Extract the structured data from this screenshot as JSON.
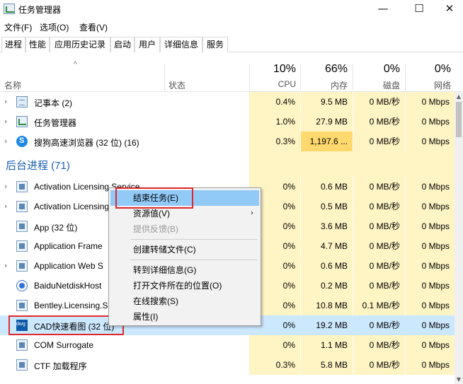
{
  "window": {
    "title": "任务管理器",
    "minimize_glyph": "—",
    "maximize_glyph": "☐",
    "close_glyph": "✕"
  },
  "menubar": {
    "items": [
      "文件(F)",
      "选项(O)",
      "查看(V)"
    ]
  },
  "tabs": {
    "items": [
      "进程",
      "性能",
      "应用历史记录",
      "启动",
      "用户",
      "详细信息",
      "服务"
    ],
    "active": "进程"
  },
  "columns": {
    "sort_indicator": "^",
    "name": "名称",
    "status": "状态",
    "cpu": {
      "percent": "10%",
      "label": "CPU"
    },
    "memory": {
      "percent": "66%",
      "label": "内存"
    },
    "disk": {
      "percent": "0%",
      "label": "磁盘"
    },
    "network": {
      "percent": "0%",
      "label": "网络"
    }
  },
  "apps": [
    {
      "name": "记事本 (2)",
      "icon": "notepad-icon",
      "expander": "›",
      "cpu": "0.4%",
      "memory": "9.5 MB",
      "disk": "0 MB/秒",
      "network": "0 Mbps"
    },
    {
      "name": "任务管理器",
      "icon": "task-manager-icon",
      "expander": "›",
      "cpu": "1.0%",
      "memory": "27.9 MB",
      "disk": "0 MB/秒",
      "network": "0 Mbps"
    },
    {
      "name": "搜狗高速浏览器 (32 位) (16)",
      "icon": "sogou-browser-icon",
      "expander": "›",
      "cpu": "0.3%",
      "memory": "1,197.6 ...",
      "disk": "0 MB/秒",
      "network": "0 Mbps"
    }
  ],
  "background_group": {
    "label": "后台进程 (71)"
  },
  "background": [
    {
      "name": "Activation Licensing Service",
      "icon": "service-icon",
      "expander": "›",
      "cpu": "0%",
      "memory": "0.6 MB",
      "disk": "0 MB/秒",
      "network": "0 Mbps"
    },
    {
      "name": "Activation Licensing",
      "icon": "service-icon",
      "expander": "›",
      "cpu": "0%",
      "memory": "0.5 MB",
      "disk": "0 MB/秒",
      "network": "0 Mbps"
    },
    {
      "name": "App (32 位)",
      "icon": "app-icon",
      "expander": "",
      "cpu": "0%",
      "memory": "3.6 MB",
      "disk": "0 MB/秒",
      "network": "0 Mbps"
    },
    {
      "name": "Application Frame",
      "icon": "app-icon",
      "expander": "",
      "cpu": "0%",
      "memory": "4.7 MB",
      "disk": "0 MB/秒",
      "network": "0 Mbps"
    },
    {
      "name": "Application Web S",
      "icon": "app-icon",
      "expander": "›",
      "cpu": "0%",
      "memory": "0.6 MB",
      "disk": "0 MB/秒",
      "network": "0 Mbps"
    },
    {
      "name": "BaiduNetdiskHost",
      "icon": "baidu-netdisk-icon",
      "expander": "",
      "cpu": "0%",
      "memory": "0.2 MB",
      "disk": "0 MB/秒",
      "network": "0 Mbps"
    },
    {
      "name": "Bentley.Licensing.S",
      "icon": "app-icon",
      "expander": "",
      "cpu": "0%",
      "memory": "10.8 MB",
      "disk": "0.1 MB/秒",
      "network": "0 Mbps"
    },
    {
      "name": "CAD快速看图 (32 位)",
      "icon": "cad-viewer-icon",
      "expander": "",
      "cpu": "0%",
      "memory": "19.2 MB",
      "disk": "0 MB/秒",
      "network": "0 Mbps",
      "selected": true
    },
    {
      "name": "COM Surrogate",
      "icon": "app-icon",
      "expander": "",
      "cpu": "0%",
      "memory": "1.1 MB",
      "disk": "0 MB/秒",
      "network": "0 Mbps"
    },
    {
      "name": "CTF 加载程序",
      "icon": "app-icon",
      "expander": "",
      "cpu": "0.3%",
      "memory": "5.8 MB",
      "disk": "0 MB/秒",
      "network": "0 Mbps"
    }
  ],
  "context_menu": {
    "end_task": "结束任务(E)",
    "resource_values": "资源值(V)",
    "submenu_arrow": "›",
    "feedback": "提供反馈(B)",
    "create_dump": "创建转储文件(C)",
    "go_to_details": "转到详细信息(G)",
    "open_file_location": "打开文件所在的位置(O)",
    "search_online": "在线搜索(S)",
    "properties": "属性(I)"
  },
  "scrollbar": {
    "up_glyph": "▲",
    "down_glyph": "▼"
  }
}
